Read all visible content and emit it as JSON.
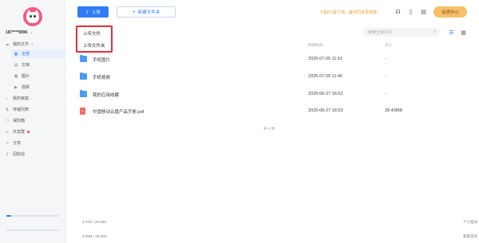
{
  "account": {
    "phone": "187****9096"
  },
  "sidebar": {
    "my_files": "我的文件",
    "sub_items": [
      "全部",
      "文档",
      "图片",
      "视频"
    ],
    "items": [
      {
        "label": "我的家庭"
      },
      {
        "label": "传输列表"
      },
      {
        "label": "保险箱"
      },
      {
        "label": "共享群"
      },
      {
        "label": "分享"
      },
      {
        "label": "回收站"
      }
    ]
  },
  "storage": {
    "personal": {
      "used": "1.72G / 20.00G",
      "label": "个人空间",
      "fraction": 0.09
    },
    "family": {
      "used": "0.00M / 20.00G",
      "label": "家庭空间",
      "fraction": 0.0
    }
  },
  "toolbar": {
    "upload_label": "上传",
    "new_folder_label": "新建文件夹",
    "promo_text": "下载PC客户端，备份同步更便捷",
    "vip_label": "会员中心"
  },
  "dropdown": {
    "options": [
      "上传文件",
      "上传文件夹"
    ]
  },
  "search": {
    "placeholder": "搜索全部文件"
  },
  "table": {
    "headers": {
      "modified": "修改时间 ↓",
      "size": "大小"
    },
    "rows": [
      {
        "name": "手机图片",
        "date": "2025-07-05  11:51",
        "size": "-"
      },
      {
        "name": "手机视频",
        "date": "2025-07-05  11:46",
        "size": "-"
      },
      {
        "name": "我的应用收藏",
        "date": "2025-06-27  16:53",
        "size": "-"
      },
      {
        "name": "中国移动云盘产品手册.pdf",
        "date": "2025-06-27  16:53",
        "size": "28.40MB"
      }
    ],
    "count_text": "共 4 项"
  },
  "colors": {
    "accent": "#2f7cf6",
    "promo": "#f0a03a",
    "vip": "#f6c06a",
    "highlight_border": "#e0353b"
  }
}
